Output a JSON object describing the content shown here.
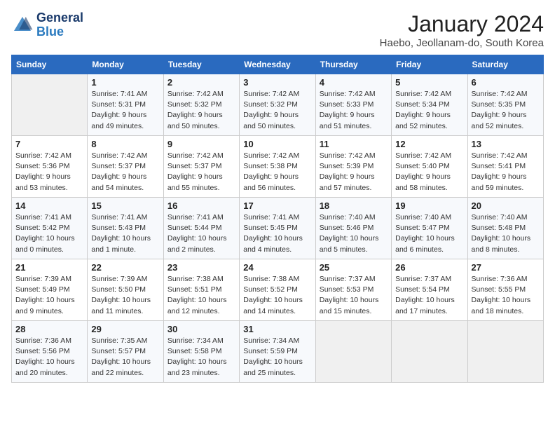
{
  "header": {
    "logo_line1": "General",
    "logo_line2": "Blue",
    "month": "January 2024",
    "location": "Haebo, Jeollanam-do, South Korea"
  },
  "days_of_week": [
    "Sunday",
    "Monday",
    "Tuesday",
    "Wednesday",
    "Thursday",
    "Friday",
    "Saturday"
  ],
  "weeks": [
    [
      {
        "day": "",
        "info": ""
      },
      {
        "day": "1",
        "info": "Sunrise: 7:41 AM\nSunset: 5:31 PM\nDaylight: 9 hours\nand 49 minutes."
      },
      {
        "day": "2",
        "info": "Sunrise: 7:42 AM\nSunset: 5:32 PM\nDaylight: 9 hours\nand 50 minutes."
      },
      {
        "day": "3",
        "info": "Sunrise: 7:42 AM\nSunset: 5:32 PM\nDaylight: 9 hours\nand 50 minutes."
      },
      {
        "day": "4",
        "info": "Sunrise: 7:42 AM\nSunset: 5:33 PM\nDaylight: 9 hours\nand 51 minutes."
      },
      {
        "day": "5",
        "info": "Sunrise: 7:42 AM\nSunset: 5:34 PM\nDaylight: 9 hours\nand 52 minutes."
      },
      {
        "day": "6",
        "info": "Sunrise: 7:42 AM\nSunset: 5:35 PM\nDaylight: 9 hours\nand 52 minutes."
      }
    ],
    [
      {
        "day": "7",
        "info": "Sunrise: 7:42 AM\nSunset: 5:36 PM\nDaylight: 9 hours\nand 53 minutes."
      },
      {
        "day": "8",
        "info": "Sunrise: 7:42 AM\nSunset: 5:37 PM\nDaylight: 9 hours\nand 54 minutes."
      },
      {
        "day": "9",
        "info": "Sunrise: 7:42 AM\nSunset: 5:37 PM\nDaylight: 9 hours\nand 55 minutes."
      },
      {
        "day": "10",
        "info": "Sunrise: 7:42 AM\nSunset: 5:38 PM\nDaylight: 9 hours\nand 56 minutes."
      },
      {
        "day": "11",
        "info": "Sunrise: 7:42 AM\nSunset: 5:39 PM\nDaylight: 9 hours\nand 57 minutes."
      },
      {
        "day": "12",
        "info": "Sunrise: 7:42 AM\nSunset: 5:40 PM\nDaylight: 9 hours\nand 58 minutes."
      },
      {
        "day": "13",
        "info": "Sunrise: 7:42 AM\nSunset: 5:41 PM\nDaylight: 9 hours\nand 59 minutes."
      }
    ],
    [
      {
        "day": "14",
        "info": "Sunrise: 7:41 AM\nSunset: 5:42 PM\nDaylight: 10 hours\nand 0 minutes."
      },
      {
        "day": "15",
        "info": "Sunrise: 7:41 AM\nSunset: 5:43 PM\nDaylight: 10 hours\nand 1 minute."
      },
      {
        "day": "16",
        "info": "Sunrise: 7:41 AM\nSunset: 5:44 PM\nDaylight: 10 hours\nand 2 minutes."
      },
      {
        "day": "17",
        "info": "Sunrise: 7:41 AM\nSunset: 5:45 PM\nDaylight: 10 hours\nand 4 minutes."
      },
      {
        "day": "18",
        "info": "Sunrise: 7:40 AM\nSunset: 5:46 PM\nDaylight: 10 hours\nand 5 minutes."
      },
      {
        "day": "19",
        "info": "Sunrise: 7:40 AM\nSunset: 5:47 PM\nDaylight: 10 hours\nand 6 minutes."
      },
      {
        "day": "20",
        "info": "Sunrise: 7:40 AM\nSunset: 5:48 PM\nDaylight: 10 hours\nand 8 minutes."
      }
    ],
    [
      {
        "day": "21",
        "info": "Sunrise: 7:39 AM\nSunset: 5:49 PM\nDaylight: 10 hours\nand 9 minutes."
      },
      {
        "day": "22",
        "info": "Sunrise: 7:39 AM\nSunset: 5:50 PM\nDaylight: 10 hours\nand 11 minutes."
      },
      {
        "day": "23",
        "info": "Sunrise: 7:38 AM\nSunset: 5:51 PM\nDaylight: 10 hours\nand 12 minutes."
      },
      {
        "day": "24",
        "info": "Sunrise: 7:38 AM\nSunset: 5:52 PM\nDaylight: 10 hours\nand 14 minutes."
      },
      {
        "day": "25",
        "info": "Sunrise: 7:37 AM\nSunset: 5:53 PM\nDaylight: 10 hours\nand 15 minutes."
      },
      {
        "day": "26",
        "info": "Sunrise: 7:37 AM\nSunset: 5:54 PM\nDaylight: 10 hours\nand 17 minutes."
      },
      {
        "day": "27",
        "info": "Sunrise: 7:36 AM\nSunset: 5:55 PM\nDaylight: 10 hours\nand 18 minutes."
      }
    ],
    [
      {
        "day": "28",
        "info": "Sunrise: 7:36 AM\nSunset: 5:56 PM\nDaylight: 10 hours\nand 20 minutes."
      },
      {
        "day": "29",
        "info": "Sunrise: 7:35 AM\nSunset: 5:57 PM\nDaylight: 10 hours\nand 22 minutes."
      },
      {
        "day": "30",
        "info": "Sunrise: 7:34 AM\nSunset: 5:58 PM\nDaylight: 10 hours\nand 23 minutes."
      },
      {
        "day": "31",
        "info": "Sunrise: 7:34 AM\nSunset: 5:59 PM\nDaylight: 10 hours\nand 25 minutes."
      },
      {
        "day": "",
        "info": ""
      },
      {
        "day": "",
        "info": ""
      },
      {
        "day": "",
        "info": ""
      }
    ]
  ]
}
